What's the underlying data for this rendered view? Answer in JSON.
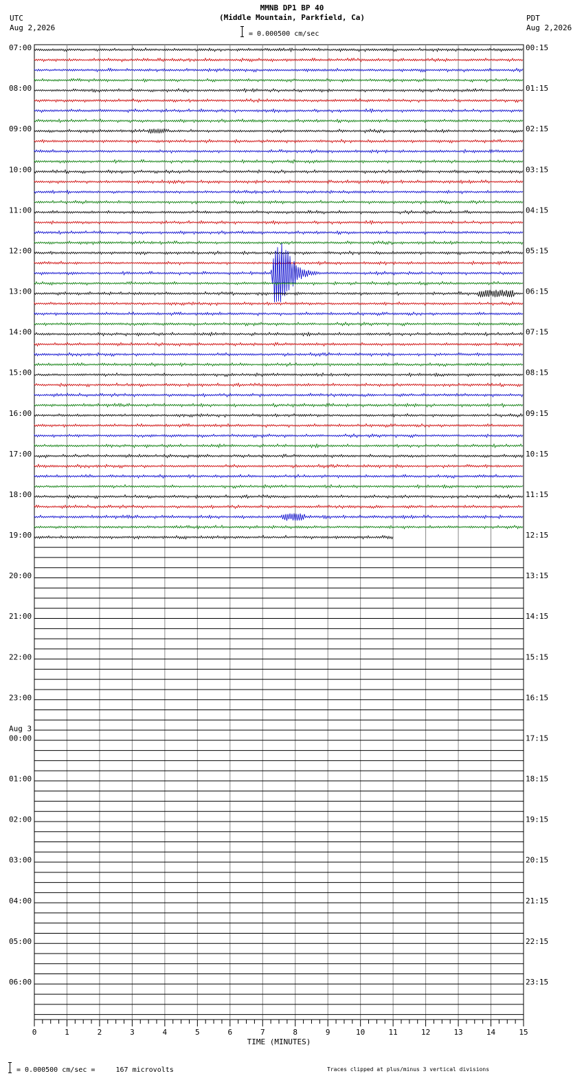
{
  "header": {
    "station": "MMNB DP1 BP 40",
    "location": "(Middle Mountain, Parkfield, Ca)",
    "scale": "= 0.000500 cm/sec",
    "left_tz": "UTC",
    "left_date": "Aug 2,2026",
    "right_tz": "PDT",
    "right_date": "Aug 2,2026"
  },
  "footer": {
    "scale_note": "= 0.000500 cm/sec =     167 microvolts",
    "clip_note": "Traces clipped at plus/minus 3 vertical divisions"
  },
  "chart_data": {
    "type": "line",
    "title": "MMNB DP1 BP 40",
    "subtitle": "(Middle Mountain, Parkfield, Ca)",
    "xlabel": "TIME (MINUTES)",
    "xlim": [
      0,
      15
    ],
    "x_ticks": [
      "0",
      "1",
      "2",
      "3",
      "4",
      "5",
      "6",
      "7",
      "8",
      "9",
      "10",
      "11",
      "12",
      "13",
      "14",
      "15"
    ],
    "rows_total": 96,
    "minutes_per_row": 15,
    "recorded_rows": 49,
    "last_row_end_minute": 11,
    "trace_colors": [
      "#000000",
      "#cc0000",
      "#0000cc",
      "#007700"
    ],
    "grid": true,
    "left_labels": [
      {
        "row": 0,
        "text": "07:00"
      },
      {
        "row": 4,
        "text": "08:00"
      },
      {
        "row": 8,
        "text": "09:00"
      },
      {
        "row": 12,
        "text": "10:00"
      },
      {
        "row": 16,
        "text": "11:00"
      },
      {
        "row": 20,
        "text": "12:00"
      },
      {
        "row": 24,
        "text": "13:00"
      },
      {
        "row": 28,
        "text": "14:00"
      },
      {
        "row": 32,
        "text": "15:00"
      },
      {
        "row": 36,
        "text": "16:00"
      },
      {
        "row": 40,
        "text": "17:00"
      },
      {
        "row": 44,
        "text": "18:00"
      },
      {
        "row": 48,
        "text": "19:00"
      },
      {
        "row": 52,
        "text": "20:00"
      },
      {
        "row": 56,
        "text": "21:00"
      },
      {
        "row": 60,
        "text": "22:00"
      },
      {
        "row": 64,
        "text": "23:00"
      },
      {
        "row": 68,
        "text": "00:00",
        "date": "Aug 3"
      },
      {
        "row": 72,
        "text": "01:00"
      },
      {
        "row": 76,
        "text": "02:00"
      },
      {
        "row": 80,
        "text": "03:00"
      },
      {
        "row": 84,
        "text": "04:00"
      },
      {
        "row": 88,
        "text": "05:00"
      },
      {
        "row": 92,
        "text": "06:00"
      }
    ],
    "right_labels": [
      {
        "row": 0,
        "text": "00:15"
      },
      {
        "row": 4,
        "text": "01:15"
      },
      {
        "row": 8,
        "text": "02:15"
      },
      {
        "row": 12,
        "text": "03:15"
      },
      {
        "row": 16,
        "text": "04:15"
      },
      {
        "row": 20,
        "text": "05:15"
      },
      {
        "row": 24,
        "text": "06:15"
      },
      {
        "row": 28,
        "text": "07:15"
      },
      {
        "row": 32,
        "text": "08:15"
      },
      {
        "row": 36,
        "text": "09:15"
      },
      {
        "row": 40,
        "text": "10:15"
      },
      {
        "row": 44,
        "text": "11:15"
      },
      {
        "row": 48,
        "text": "12:15"
      },
      {
        "row": 52,
        "text": "13:15"
      },
      {
        "row": 56,
        "text": "14:15"
      },
      {
        "row": 60,
        "text": "15:15"
      },
      {
        "row": 64,
        "text": "16:15"
      },
      {
        "row": 68,
        "text": "17:15"
      },
      {
        "row": 72,
        "text": "18:15"
      },
      {
        "row": 76,
        "text": "19:15"
      },
      {
        "row": 80,
        "text": "20:15"
      },
      {
        "row": 84,
        "text": "21:15"
      },
      {
        "row": 88,
        "text": "22:15"
      },
      {
        "row": 92,
        "text": "23:15"
      }
    ],
    "events": [
      {
        "row": 22,
        "start_minute": 7.25,
        "peak_minute": 7.35,
        "end_minute": 10.5,
        "amplitude_divisions": 3,
        "clipped": true,
        "color": "#0000cc"
      },
      {
        "row": 24,
        "start_minute": 13.6,
        "end_minute": 14.7,
        "amplitude_divisions": 0.15,
        "color": "#000000"
      },
      {
        "row": 46,
        "start_minute": 7.6,
        "end_minute": 8.3,
        "amplitude_divisions": 0.15,
        "color": "#0000cc"
      },
      {
        "row": 8,
        "start_minute": 3.5,
        "end_minute": 4.0,
        "amplitude_divisions": 0.1,
        "color": "#007700"
      }
    ]
  }
}
